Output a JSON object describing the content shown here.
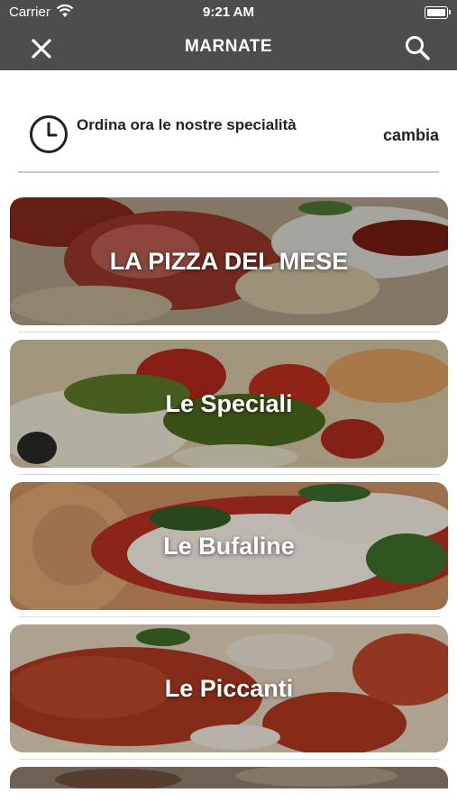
{
  "status_bar": {
    "carrier": "Carrier",
    "time": "9:21 AM"
  },
  "nav": {
    "title": "MARNATE",
    "close_icon": "close-icon",
    "search_icon": "search-icon"
  },
  "order": {
    "text": "Ordina ora le nostre specialità",
    "change_label": "cambia",
    "icon": "clock-icon"
  },
  "categories": [
    {
      "label": "LA PIZZA DEL MESE"
    },
    {
      "label": "Le Speciali"
    },
    {
      "label": "Le Bufaline"
    },
    {
      "label": "Le Piccanti"
    }
  ],
  "colors": {
    "bar": "#4d4d4d",
    "text": "#222222",
    "divider": "#c9c9c9"
  }
}
